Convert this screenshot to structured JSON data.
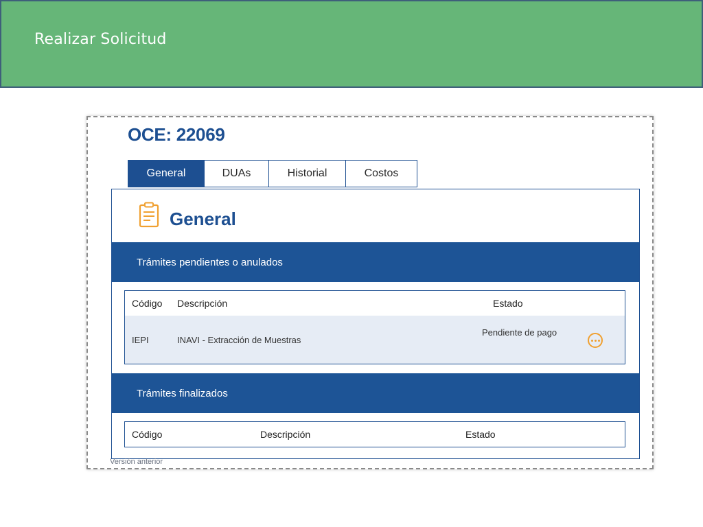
{
  "banner": {
    "title": "Realizar Solicitud"
  },
  "oce": {
    "title": "OCE: 22069"
  },
  "tabs": [
    {
      "label": "General",
      "active": true
    },
    {
      "label": "DUAs",
      "active": false
    },
    {
      "label": "Historial",
      "active": false
    },
    {
      "label": "Costos",
      "active": false
    }
  ],
  "panel": {
    "title": "General",
    "icon": "clipboard-icon",
    "pending": {
      "header": "Trámites pendientes o anulados",
      "columns": {
        "code": "Código",
        "description": "Descripción",
        "status": "Estado"
      },
      "rows": [
        {
          "code": "IEPI",
          "description": "INAVI - Extracción de Muestras",
          "status": "Pendiente de pago",
          "action_icon": "more-options-icon"
        }
      ]
    },
    "finished": {
      "header": "Trámites finalizados",
      "columns": {
        "code": "Código",
        "description": "Descripción",
        "status": "Estado"
      }
    }
  },
  "footer": {
    "version_link": "Versión anterior"
  },
  "colors": {
    "banner": "#66b678",
    "primary": "#1d4f91",
    "accent": "#f0a030",
    "row_bg": "#e6ecf5"
  }
}
